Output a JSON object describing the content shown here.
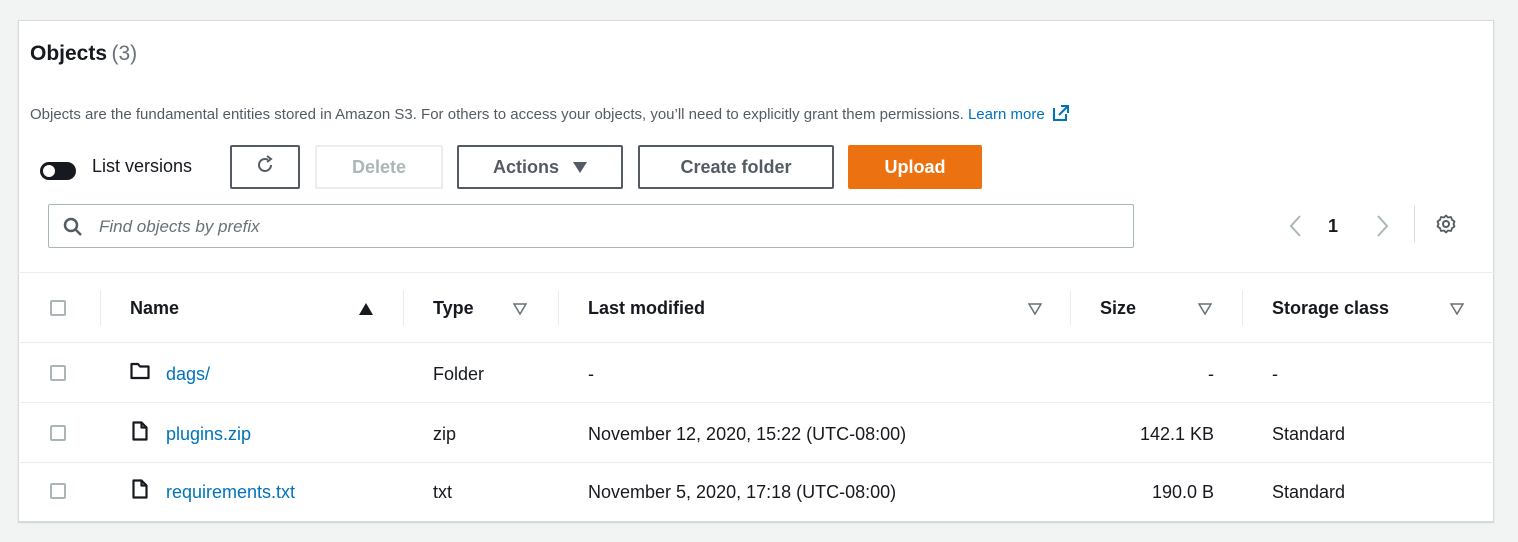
{
  "header": {
    "title": "Objects",
    "count": "(3)",
    "description": "Objects are the fundamental entities stored in Amazon S3. For others to access your objects, you’ll need to explicitly grant them permissions.",
    "learn_more": "Learn more"
  },
  "toolbar": {
    "list_versions_label": "List versions",
    "list_versions_on": false,
    "delete_label": "Delete",
    "actions_label": "Actions",
    "create_folder_label": "Create folder",
    "upload_label": "Upload"
  },
  "search": {
    "placeholder": "Find objects by prefix"
  },
  "pagination": {
    "current_page": "1"
  },
  "table": {
    "columns": {
      "name": "Name",
      "type": "Type",
      "last_modified": "Last modified",
      "size": "Size",
      "storage_class": "Storage class"
    },
    "rows": [
      {
        "name": "dags/",
        "kind": "folder",
        "type": "Folder",
        "last_modified": "-",
        "size": "-",
        "storage_class": "-"
      },
      {
        "name": "plugins.zip",
        "kind": "file",
        "type": "zip",
        "last_modified": "November 12, 2020, 15:22 (UTC-08:00)",
        "size": "142.1 KB",
        "storage_class": "Standard"
      },
      {
        "name": "requirements.txt",
        "kind": "file",
        "type": "txt",
        "last_modified": "November 5, 2020, 17:18 (UTC-08:00)",
        "size": "190.0 B",
        "storage_class": "Standard"
      }
    ]
  },
  "colors": {
    "accent": "#ec7211",
    "link": "#0073bb"
  },
  "icons": {
    "folder": "folder-icon",
    "file": "file-icon",
    "refresh": "refresh-icon",
    "search": "search-icon",
    "settings": "gear-icon",
    "external": "external-link-icon"
  }
}
